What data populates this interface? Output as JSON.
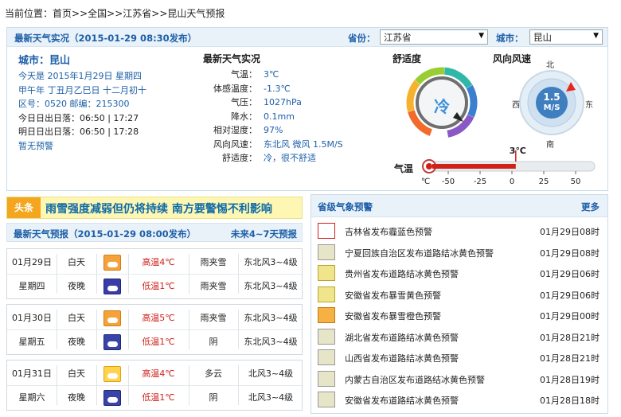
{
  "breadcrumb": {
    "prefix": "当前位置：",
    "items": [
      "首页",
      "全国",
      "江苏省",
      "昆山天气预报"
    ],
    "separator": ">>"
  },
  "observation_bar": {
    "title": "最新天气实况（2015-01-29 08:30发布）",
    "province_label": "省份：",
    "province_value": "江苏省",
    "city_label": "城市：",
    "city_value": "昆山"
  },
  "city_info": {
    "city": "城市：昆山",
    "today": "今天是 2015年1月29日 星期四",
    "lunar": "甲午年 丁丑月乙巳日 十二月初十",
    "codes": "区号：0520  邮编：215300",
    "today_sun": "今日日出日落：06:50 | 17:27",
    "tomorrow_sun": "明日日出日落：06:50 | 17:28",
    "warning": "暂无预警"
  },
  "realtime": {
    "heading": "最新天气实况",
    "rows": [
      {
        "k": "气温：",
        "v": "3℃"
      },
      {
        "k": "体感温度：",
        "v": "-1.3℃"
      },
      {
        "k": "气压：",
        "v": "1027hPa"
      },
      {
        "k": "降水：",
        "v": "0.1mm"
      },
      {
        "k": "相对湿度：",
        "v": "97%"
      },
      {
        "k": "风向风速：",
        "v": "东北风 微风 1.5M/S"
      },
      {
        "k": "舒适度：",
        "v": "冷，很不舒适"
      }
    ]
  },
  "comfort_gauge": {
    "label": "舒适度",
    "value_text": "冷"
  },
  "wind_gauge": {
    "label": "风向风速",
    "speed": "1.5",
    "unit": "M/S",
    "north": "北",
    "south": "南",
    "east": "东",
    "west": "西"
  },
  "temp_gauge": {
    "label": "气温",
    "current": "3℃",
    "current_value": 3,
    "unit": "℃",
    "min": -60,
    "max": 60,
    "ticks": [
      "-50",
      "-25",
      "0",
      "25",
      "50"
    ]
  },
  "headline": {
    "tag": "头条",
    "text": "雨雪强度减弱但仍将持续  南方要警惕不利影响"
  },
  "forecast": {
    "title": "最新天气预报（2015-01-29 08:00发布）",
    "more": "未来4~7天预报",
    "days": [
      {
        "date": "01月29日",
        "weekday": "星期四",
        "day": {
          "label": "白天",
          "icon": "rain-snow-icon",
          "temp": "高温4℃",
          "weather": "雨夹雪",
          "wind": "东北风3~4级"
        },
        "night": {
          "label": "夜晚",
          "icon": "rain-snow-night-icon",
          "temp": "低温1℃",
          "weather": "雨夹雪",
          "wind": "东北风3~4级"
        }
      },
      {
        "date": "01月30日",
        "weekday": "星期五",
        "day": {
          "label": "白天",
          "icon": "rain-snow-icon",
          "temp": "高温5℃",
          "weather": "雨夹雪",
          "wind": "东北风3~4级"
        },
        "night": {
          "label": "夜晚",
          "icon": "overcast-night-icon",
          "temp": "低温1℃",
          "weather": "阴",
          "wind": "东北风3~4级"
        }
      },
      {
        "date": "01月31日",
        "weekday": "星期六",
        "day": {
          "label": "白天",
          "icon": "partly-cloudy-icon",
          "temp": "高温4℃",
          "weather": "多云",
          "wind": "北风3~4级"
        },
        "night": {
          "label": "夜晚",
          "icon": "overcast-night-icon",
          "temp": "低温1℃",
          "weather": "阴",
          "wind": "北风3~4级"
        }
      }
    ]
  },
  "warnings": {
    "title": "省级气象预警",
    "more": "更多",
    "items": [
      {
        "text": "吉林省发布霾蓝色预警",
        "date": "01月29日08时",
        "level": "red"
      },
      {
        "text": "宁夏回族自治区发布道路结冰黄色预警",
        "date": "01月29日08时",
        "level": "grey"
      },
      {
        "text": "贵州省发布道路结冰黄色预警",
        "date": "01月29日06时",
        "level": "yellow"
      },
      {
        "text": "安徽省发布暴雪黄色预警",
        "date": "01月29日06时",
        "level": "yellow"
      },
      {
        "text": "安徽省发布暴雪橙色预警",
        "date": "01月29日00时",
        "level": "orange"
      },
      {
        "text": "湖北省发布道路结冰黄色预警",
        "date": "01月28日21时",
        "level": "grey"
      },
      {
        "text": "山西省发布道路结冰黄色预警",
        "date": "01月28日21时",
        "level": "grey"
      },
      {
        "text": "内蒙古自治区发布道路结冰黄色预警",
        "date": "01月28日19时",
        "level": "grey"
      },
      {
        "text": "安徽省发布道路结冰黄色预警",
        "date": "01月28日18时",
        "level": "grey"
      }
    ]
  },
  "colors": {
    "accent": "#1d5fa8",
    "bar_bg": "#e9f2f9",
    "high_temp": "#d0201a",
    "headline_bg": "#fdf7b3"
  }
}
